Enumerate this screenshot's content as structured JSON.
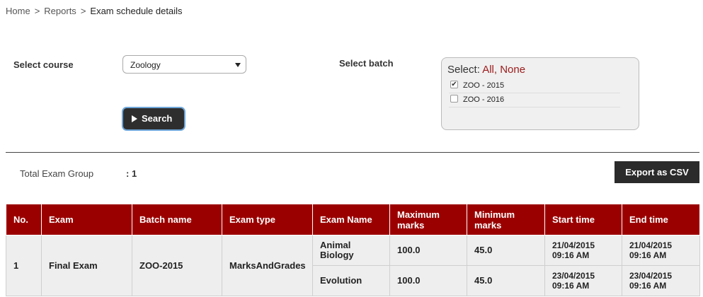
{
  "breadcrumb": {
    "home": "Home",
    "reports": "Reports",
    "current": "Exam schedule details",
    "separator": ">"
  },
  "filters": {
    "course_label": "Select course",
    "course_value": "Zoology",
    "batch_label": "Select batch",
    "batch_select_prefix": "Select:",
    "batch_select_all": "All,",
    "batch_select_none": "None",
    "batches": [
      {
        "label": "ZOO - 2015",
        "checked": true,
        "mark": "✔"
      },
      {
        "label": "ZOO - 2016",
        "checked": false,
        "mark": ""
      }
    ],
    "search_label": "Search"
  },
  "summary": {
    "total_label": "Total Exam Group",
    "total_value": ": 1",
    "export_label": "Export as CSV"
  },
  "colors": {
    "header_bg": "#9b0000",
    "link_red": "#9b1a1a",
    "dark_button": "#2b2b2b"
  },
  "table_left": {
    "headers": [
      "No.",
      "Exam",
      "Batch name",
      "Exam type"
    ],
    "row": {
      "no": "1",
      "exam": "Final Exam",
      "batch": "ZOO-2015",
      "type": "MarksAndGrades"
    }
  },
  "table_right": {
    "headers": [
      "Exam Name",
      "Maximum marks",
      "Minimum marks",
      "Start time",
      "End time"
    ],
    "rows": [
      {
        "name": "Animal Biology",
        "max": "100.0",
        "min": "45.0",
        "start": "21/04/2015 09:16 AM",
        "end": "21/04/2015 09:16 AM"
      },
      {
        "name": "Evolution",
        "max": "100.0",
        "min": "45.0",
        "start": "23/04/2015 09:16 AM",
        "end": "23/04/2015 09:16 AM"
      }
    ]
  }
}
